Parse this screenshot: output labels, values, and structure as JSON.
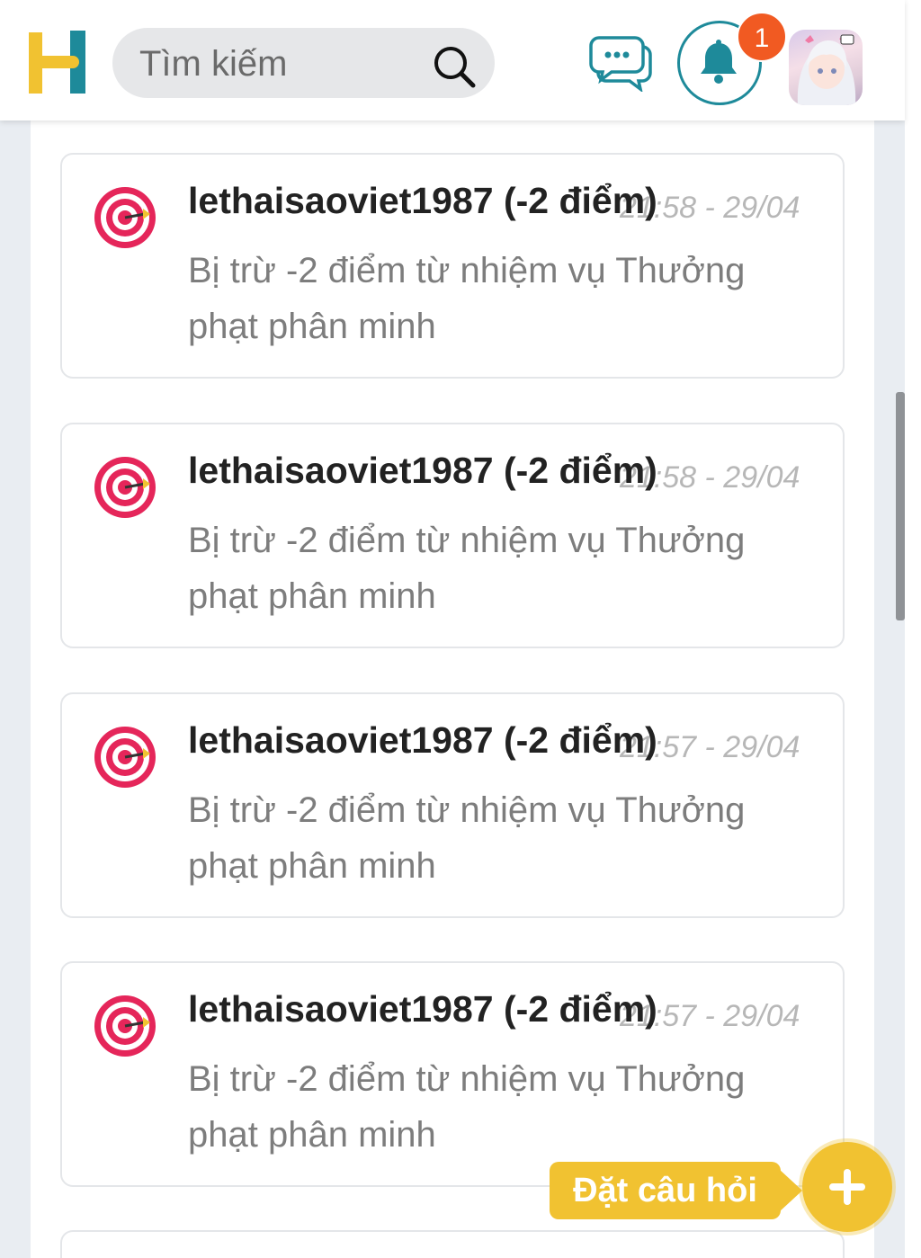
{
  "header": {
    "search_placeholder": "Tìm kiếm",
    "notification_count": "1"
  },
  "notifications": [
    {
      "title": "lethaisaoviet1987 (-2 điểm)",
      "time": "21:58 - 29/04",
      "message": "Bị trừ -2 điểm từ nhiệm vụ Thưởng phạt phân minh"
    },
    {
      "title": "lethaisaoviet1987 (-2 điểm)",
      "time": "21:58 - 29/04",
      "message": "Bị trừ -2 điểm từ nhiệm vụ Thưởng phạt phân minh"
    },
    {
      "title": "lethaisaoviet1987 (-2 điểm)",
      "time": "21:57 - 29/04",
      "message": "Bị trừ -2 điểm từ nhiệm vụ Thưởng phạt phân minh"
    },
    {
      "title": "lethaisaoviet1987 (-2 điểm)",
      "time": "21:57 - 29/04",
      "message": "Bị trừ -2 điểm từ nhiệm vụ Thưởng phạt phân minh"
    }
  ],
  "ask_button": {
    "label": "Đặt câu hỏi"
  },
  "icons": {
    "logo": "hoc24-logo-icon",
    "search": "search-icon",
    "chat": "chat-bubbles-icon",
    "bell": "bell-icon",
    "notification_type": "target-icon",
    "ask": "plus-icon"
  },
  "colors": {
    "brand_yellow": "#f1c231",
    "brand_teal": "#1e8a9a",
    "badge": "#f15a22",
    "target_red": "#e5265a"
  }
}
